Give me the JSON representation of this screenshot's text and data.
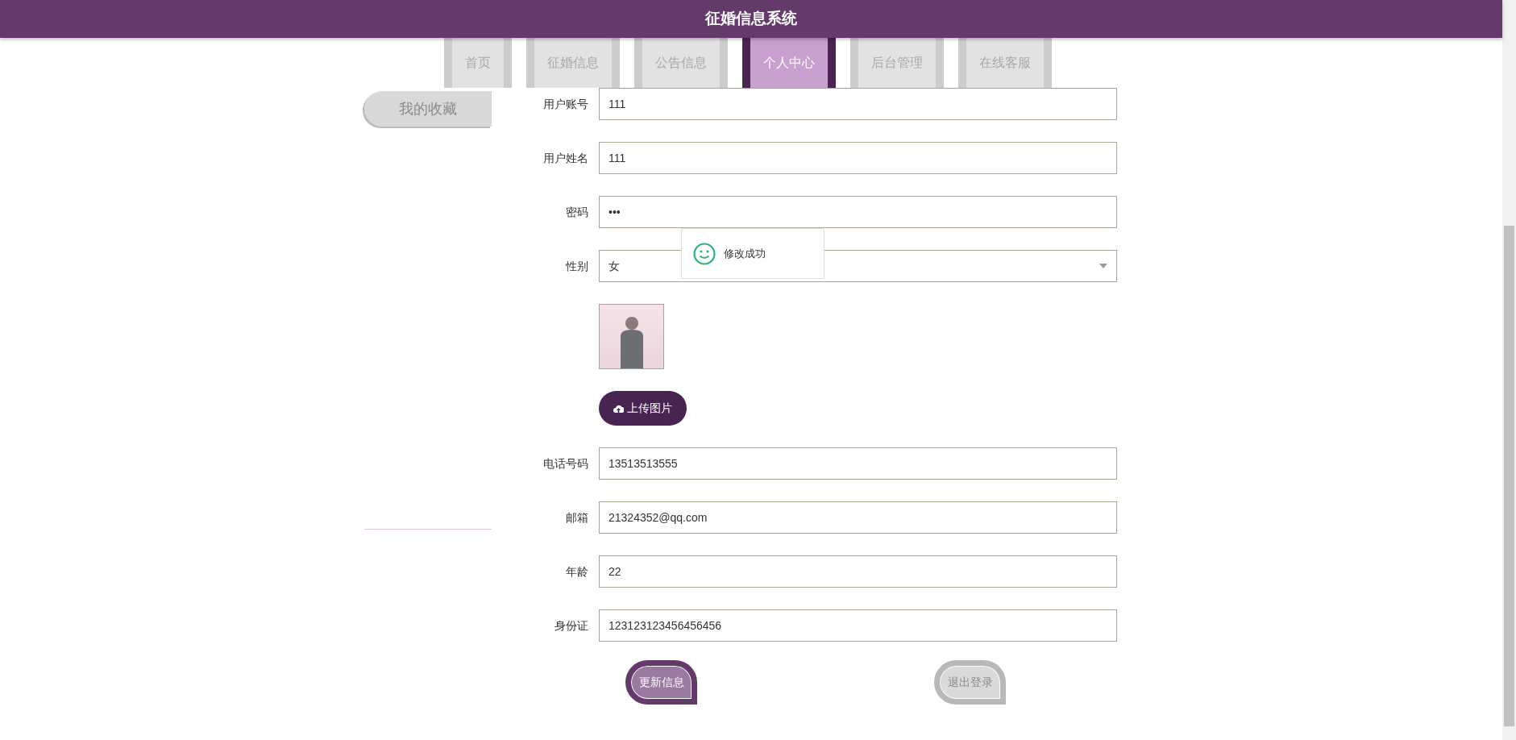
{
  "header": {
    "title": "征婚信息系统"
  },
  "nav_tabs": [
    {
      "label": "首页",
      "selected": false
    },
    {
      "label": "征婚信息",
      "selected": false
    },
    {
      "label": "公告信息",
      "selected": false
    },
    {
      "label": "个人中心",
      "selected": true
    },
    {
      "label": "后台管理",
      "selected": false
    },
    {
      "label": "在线客服",
      "selected": false
    }
  ],
  "sidebar": {
    "items": [
      {
        "label": "我的收藏"
      }
    ]
  },
  "form": {
    "fields": [
      {
        "kind": "text",
        "label": "用户账号",
        "value": "111"
      },
      {
        "kind": "text",
        "label": "用户姓名",
        "value": "111"
      },
      {
        "kind": "password",
        "label": "密码",
        "value": "•••"
      },
      {
        "kind": "select",
        "label": "性别",
        "value": "女"
      },
      {
        "kind": "photo"
      },
      {
        "kind": "upload",
        "label": "上传图片"
      },
      {
        "kind": "text",
        "label": "电话号码",
        "value": "13513513555"
      },
      {
        "kind": "text",
        "label": "邮箱",
        "value": "21324352@qq.com"
      },
      {
        "kind": "text",
        "label": "年龄",
        "value": "22"
      },
      {
        "kind": "text",
        "label": "身份证",
        "value": "123123123456456456"
      }
    ],
    "buttons": [
      {
        "kind": "primary",
        "label": "更新信息"
      },
      {
        "kind": "secondary",
        "label": "退出登录"
      }
    ]
  },
  "toast": {
    "message": "修改成功"
  }
}
